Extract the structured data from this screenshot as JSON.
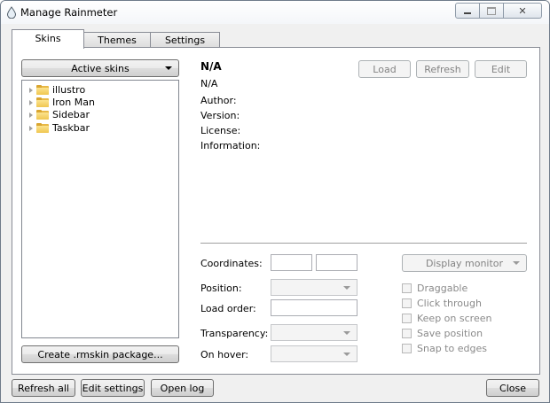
{
  "window": {
    "title": "Manage Rainmeter"
  },
  "tabs": [
    {
      "label": "Skins"
    },
    {
      "label": "Themes"
    },
    {
      "label": "Settings"
    }
  ],
  "skins": {
    "active_skins_label": "Active skins",
    "tree": [
      {
        "label": "illustro"
      },
      {
        "label": "Iron Man"
      },
      {
        "label": "Sidebar"
      },
      {
        "label": "Taskbar"
      }
    ],
    "create_package_label": "Create .rmskin package...",
    "details": {
      "name": "N/A",
      "config": "N/A",
      "author_label": "Author:",
      "version_label": "Version:",
      "license_label": "License:",
      "information_label": "Information:"
    },
    "actions": {
      "load_label": "Load",
      "refresh_label": "Refresh",
      "edit_label": "Edit"
    },
    "settings": {
      "coordinates_label": "Coordinates:",
      "display_monitor_label": "Display monitor",
      "position_label": "Position:",
      "load_order_label": "Load order:",
      "transparency_label": "Transparency:",
      "on_hover_label": "On hover:",
      "checkboxes": [
        {
          "label": "Draggable"
        },
        {
          "label": "Click through"
        },
        {
          "label": "Keep on screen"
        },
        {
          "label": "Save position"
        },
        {
          "label": "Snap to edges"
        }
      ]
    }
  },
  "footer": {
    "refresh_all_label": "Refresh all",
    "edit_settings_label": "Edit settings",
    "open_log_label": "Open log",
    "close_label": "Close"
  }
}
